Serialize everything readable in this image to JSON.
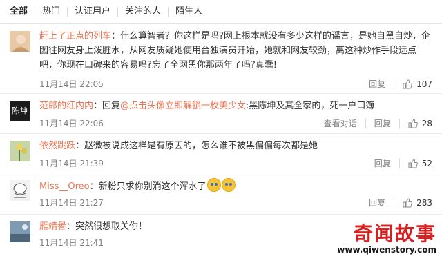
{
  "tabs": [
    "全部",
    "热门",
    "认证用户",
    "关注的人",
    "陌生人"
  ],
  "actions": {
    "reply": "回复",
    "view_thread": "查看对话"
  },
  "comments": [
    {
      "user": "赶上了正点的列车",
      "content": "：什么算智者？你这样是吗?网上根本就没有多少这样的谣言，是她自黑自炒，企图往网友身上泼脏水，从网友质疑她使用台独演员开始，她就和网友较劲，离这种炒作手段远点吧，你现在口碑来的容易吗?忘了全网黑你那两年了吗?真蠢!",
      "time": "11月14日 22:05",
      "likes": "107"
    },
    {
      "user": "范郎的红内内",
      "reply_prefix": "：回复",
      "mention": "@点击头像立即解锁一枚美少女",
      "content": ":黑陈坤及其全家的，死一户口簿",
      "time": "11月14日 22:06",
      "likes": "28"
    },
    {
      "user": "依然跳跃",
      "content": "：赵微被说成这样是有原因的，怎么谁不被黑偏偏每次都是她",
      "time": "11月14日 21:39",
      "likes": "52"
    },
    {
      "user": "Miss__Oreo",
      "content": "：新粉只求你别淌这个浑水了",
      "time": "11月14日 21:27",
      "likes": "283"
    },
    {
      "user": "雁靖譽",
      "content": "：突然很想取关你！",
      "time": "11月14日 21:41"
    }
  ],
  "avatar_2_text": "陈坤",
  "watermark": {
    "title": "奇闻故事",
    "url": "www.qiwenstory.com"
  },
  "colors": {
    "username": "#eb7350",
    "watermark": "#d92020"
  }
}
